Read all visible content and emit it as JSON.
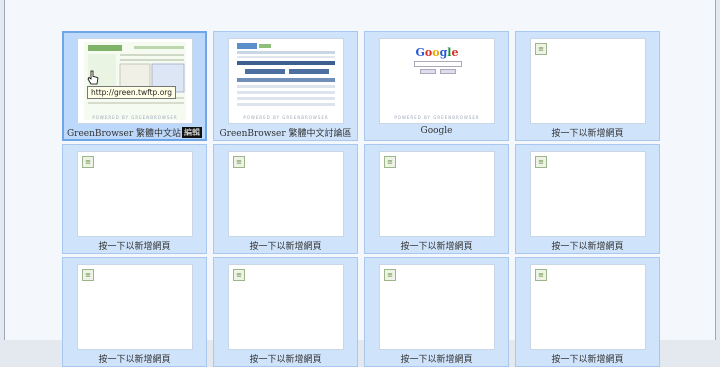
{
  "tiles": [
    {
      "label": "GreenBrowser 繁體中文站",
      "edit": "編輯",
      "tooltip": "http://green.twftp.org",
      "powered": "POWERED BY GREENBROWSER"
    },
    {
      "label": "GreenBrowser 繁體中文討論區",
      "powered": "POWERED BY GREENBROWSER"
    },
    {
      "label": "Google",
      "logo": "Google",
      "powered": "POWERED BY GREENBROWSER"
    },
    {
      "label": "按一下以新增網頁"
    },
    {
      "label": "按一下以新增網頁"
    },
    {
      "label": "按一下以新增網頁"
    },
    {
      "label": "按一下以新增網頁"
    },
    {
      "label": "按一下以新增網頁"
    },
    {
      "label": "按一下以新增網頁"
    },
    {
      "label": "按一下以新增網頁"
    },
    {
      "label": "按一下以新增網頁"
    },
    {
      "label": "按一下以新增網頁"
    }
  ],
  "colors": {
    "tile": "#cfe3fb",
    "tile_selected": "#bcd8fb",
    "border": "#a9c8ef",
    "accent": "#6fa6e8"
  },
  "icons": {
    "placeholder": "page-placeholder-icon",
    "cursor": "hand-cursor-icon"
  }
}
